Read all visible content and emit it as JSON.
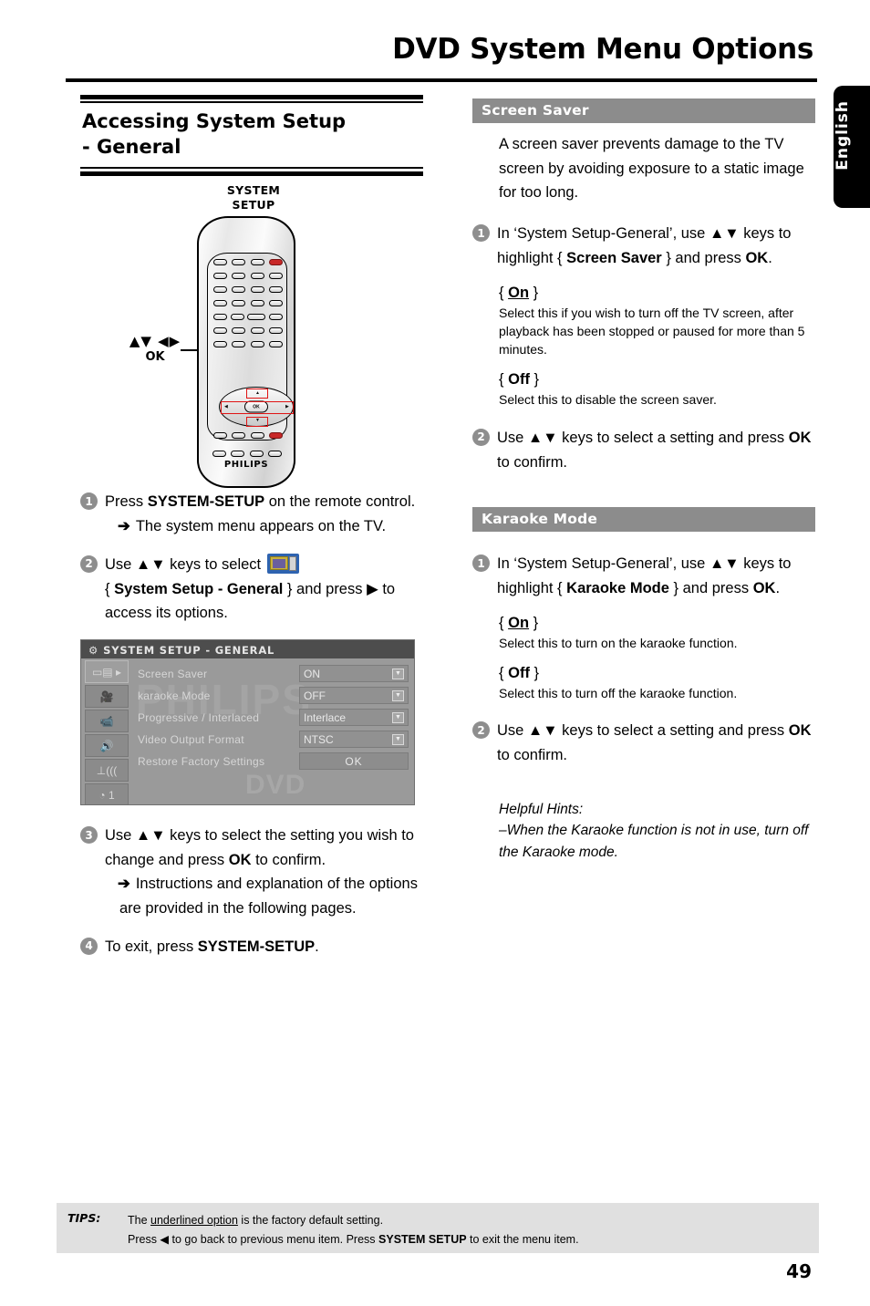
{
  "page": {
    "title": "DVD System Menu Options",
    "language_tab": "English",
    "page_number": "49"
  },
  "left": {
    "section_title_line1": "Accessing System Setup",
    "section_title_line2": "- General",
    "remote": {
      "label_top": "SYSTEM\nSETUP",
      "label_top_line1": "SYSTEM",
      "label_top_line2": "SETUP",
      "label_nav_arrows": "▲▼ ◀▶",
      "label_nav_ok": "OK",
      "brand": "PHILIPS",
      "ok_key": "OK"
    },
    "steps": [
      {
        "num": "1",
        "text_before": "Press ",
        "bold": "SYSTEM-SETUP",
        "text_after": " on the remote control.",
        "arrow_note": "The system menu appears on the TV."
      },
      {
        "num": "2",
        "part1": "Use ▲▼ keys to select ",
        "icon": "tv-remote-icon",
        "part2": "{ ",
        "bold": "System Setup - General",
        "part3": " } and press ▶ to access its options."
      },
      {
        "num": "3",
        "part1": "Use ▲▼ keys to select the setting you wish to change and press ",
        "bold": "OK",
        "part2": " to confirm.",
        "arrow_note": "Instructions and explanation of the options are provided in the following pages."
      },
      {
        "num": "4",
        "text_before": "To exit, press ",
        "bold": "SYSTEM-SETUP",
        "text_after": "."
      }
    ],
    "tv_menu": {
      "title": "SYSTEM SETUP - GENERAL",
      "watermark": "PHILIPS",
      "watermark2": "DVD",
      "sidebar_icons": [
        "tv-display-icon",
        "movie-camera-icon",
        "video-camera-icon",
        "speaker-icon",
        "antenna-icon",
        "clock-preference-icon"
      ],
      "rows": [
        {
          "label": "Screen Saver",
          "value": "ON",
          "control": "dropdown"
        },
        {
          "label": "karaoke Mode",
          "value": "OFF",
          "control": "dropdown"
        },
        {
          "label": "Progressive / Interlaced",
          "value": "Interlace",
          "control": "dropdown"
        },
        {
          "label": "Video Output Format",
          "value": "NTSC",
          "control": "dropdown"
        },
        {
          "label": "Restore Factory Settings",
          "value": "OK",
          "control": "button"
        }
      ]
    }
  },
  "right": {
    "screen_saver": {
      "heading": "Screen Saver",
      "intro": "A screen saver prevents damage to the TV screen by avoiding exposure to a static image for too long.",
      "step1": {
        "num": "1",
        "part1": "In ‘System Setup-General’, use ▲▼ keys to highlight { ",
        "bold": "Screen Saver",
        "part2": " } and press ",
        "bold2": "OK",
        "part3": "."
      },
      "option_on_label": "On",
      "option_on_desc": "Select this if you wish to turn off the TV screen, after playback has been stopped or paused for more than 5 minutes.",
      "option_off_label": "Off",
      "option_off_desc": "Select this to disable the screen saver.",
      "step2": {
        "num": "2",
        "part1": "Use ▲▼ keys to select a setting and press ",
        "bold": "OK",
        "part2": " to confirm."
      }
    },
    "karaoke_mode": {
      "heading": "Karaoke Mode",
      "step1": {
        "num": "1",
        "part1": "In ‘System Setup-General’, use ▲▼ keys to highlight { ",
        "bold": "Karaoke Mode",
        "part2": " } and press ",
        "bold2": "OK",
        "part3": "."
      },
      "option_on_label": "On",
      "option_on_desc": "Select this to turn on the karaoke function.",
      "option_off_label": "Off",
      "option_off_desc": "Select this to turn off the karaoke function.",
      "step2": {
        "num": "2",
        "part1": "Use ▲▼ keys to select a setting and press ",
        "bold": "OK",
        "part2": " to confirm."
      },
      "hints_title": "Helpful Hints:",
      "hints_body": "–When the Karaoke function is not in use, turn off the Karaoke mode."
    }
  },
  "tips": {
    "label": "TIPS:",
    "line1_a": "The ",
    "line1_u": "underlined option",
    "line1_b": " is the factory default setting.",
    "line2_a": "Press ◀ to go back to previous menu item. Press ",
    "line2_b": "SYSTEM SETUP",
    "line2_c": " to exit the menu item."
  },
  "colors": {
    "section_bar": "#8c8c8c",
    "tips_bg": "#e0e0e0",
    "step_num_bg": "#8e8e8e",
    "lang_tab_bg": "#000000"
  }
}
